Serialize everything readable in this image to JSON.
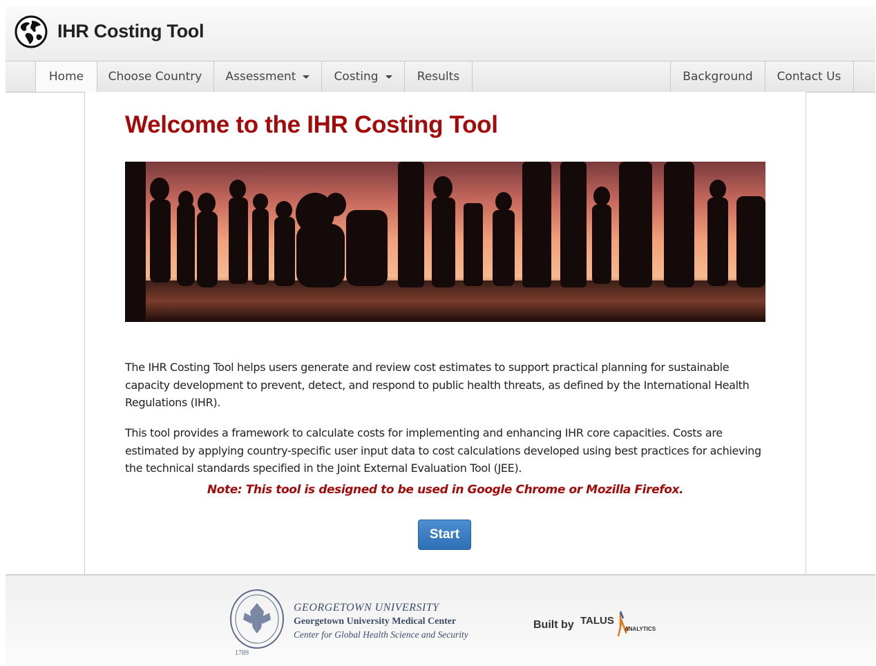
{
  "header": {
    "logo_icon": "globe-icon",
    "title": "IHR Costing Tool"
  },
  "nav": {
    "left_items": [
      {
        "label": "Home",
        "active": true
      },
      {
        "label": "Choose Country"
      },
      {
        "label": "Assessment",
        "dropdown": true
      },
      {
        "label": "Costing",
        "dropdown": true
      },
      {
        "label": "Results"
      }
    ],
    "right_items": [
      {
        "label": "Background"
      },
      {
        "label": "Contact Us"
      }
    ]
  },
  "main": {
    "title": "Welcome to the IHR Costing Tool",
    "hero_image": "silhouettes-of-people-at-sunset",
    "paragraph1": "The IHR Costing Tool helps users generate and review cost estimates to support practical planning for sustainable capacity development to prevent, detect, and respond to public health threats, as defined by the International Health Regulations (IHR).",
    "paragraph2": "This tool provides a framework to calculate costs for implementing and enhancing IHR core capacities. Costs are estimated by applying country-specific user input data to cost calculations developed using best practices for achieving the technical standards specified in the Joint External Evaluation Tool (JEE).",
    "note": "Note: This tool is designed to be used in Google Chrome or Mozilla Firefox.",
    "start_label": "Start"
  },
  "footer": {
    "university": "GEORGETOWN UNIVERSITY",
    "center": "Georgetown University Medical Center",
    "program": "Center for Global Health Science and Security",
    "seal_years": "1789",
    "built_by": "Built by",
    "talus_word": "TALUS",
    "analytics_word": "ANALYTICS"
  },
  "colors": {
    "accent_red": "#a30b0b",
    "button_blue": "#337ab7"
  }
}
